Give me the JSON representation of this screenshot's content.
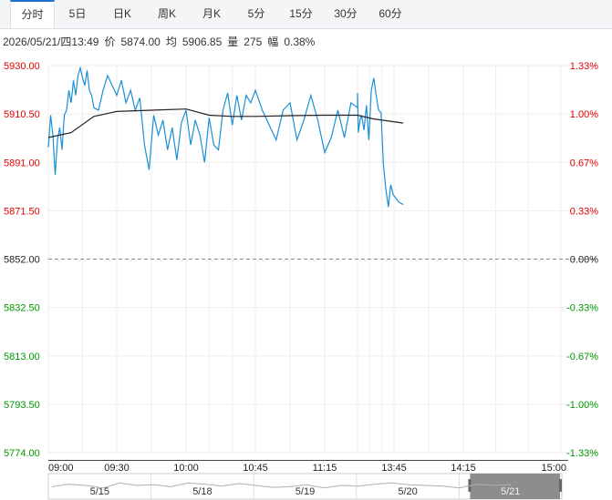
{
  "tabs": [
    {
      "label": "分时",
      "active": true
    },
    {
      "label": "5日"
    },
    {
      "label": "日K"
    },
    {
      "label": "周K"
    },
    {
      "label": "月K"
    },
    {
      "label": "5分"
    },
    {
      "label": "15分"
    },
    {
      "label": "30分"
    },
    {
      "label": "60分"
    }
  ],
  "info": {
    "datetime": "2026/05/21/四13:49",
    "price_label": "价",
    "price": "5874.00",
    "avg_label": "均",
    "avg": "5906.85",
    "vol_label": "量",
    "vol": "275",
    "amp_label": "幅",
    "amp": "0.38%"
  },
  "colors": {
    "up": "#e60000",
    "down": "#009900",
    "base": "#222222",
    "price_line": "#1b8fd6",
    "avg_line": "#222222"
  },
  "chart_data": {
    "type": "line",
    "base_price": 5852.0,
    "ylim": [
      5774.0,
      5930.0
    ],
    "y_ticks": [
      "5930.00",
      "5910.50",
      "5891.00",
      "5871.50",
      "5852.00",
      "5832.50",
      "5813.00",
      "5793.50",
      "5774.00"
    ],
    "pct_ticks": [
      "1.33%",
      "1.00%",
      "0.67%",
      "0.33%",
      "0.00%",
      "-0.33%",
      "-0.67%",
      "-1.00%",
      "-1.33%"
    ],
    "x_ticks": [
      "09:00",
      "09:30",
      "10:00",
      "10:45",
      "11:15",
      "13:45",
      "14:15",
      "15:00"
    ],
    "series": [
      {
        "key": "price",
        "x": [
          "09:00",
          "09:01",
          "09:02",
          "09:03",
          "09:04",
          "09:05",
          "09:06",
          "09:07",
          "09:08",
          "09:09",
          "09:10",
          "09:11",
          "09:12",
          "09:13",
          "09:14",
          "09:15",
          "09:16",
          "09:17",
          "09:18",
          "09:19",
          "09:20",
          "09:22",
          "09:24",
          "09:26",
          "09:28",
          "09:30",
          "09:32",
          "09:34",
          "09:36",
          "09:38",
          "09:40",
          "09:42",
          "09:44",
          "09:46",
          "09:48",
          "09:50",
          "09:52",
          "09:54",
          "09:56",
          "09:58",
          "10:00",
          "10:03",
          "10:06",
          "10:09",
          "10:12",
          "10:15",
          "10:18",
          "10:21",
          "10:24",
          "10:27",
          "10:30",
          "10:33",
          "10:36",
          "10:39",
          "10:42",
          "10:45",
          "10:48",
          "10:51",
          "10:54",
          "10:57",
          "11:00",
          "11:03",
          "11:06",
          "11:09",
          "11:12",
          "11:15",
          "11:18",
          "11:21",
          "11:24",
          "11:27",
          "11:30",
          "13:00",
          "13:01",
          "13:03",
          "13:05",
          "13:08",
          "13:11",
          "13:14",
          "13:17",
          "13:20",
          "13:23",
          "13:26",
          "13:29",
          "13:32",
          "13:35",
          "13:38",
          "13:41",
          "13:44",
          "13:47",
          "13:49"
        ],
        "values": [
          5897,
          5910,
          5902,
          5886,
          5900,
          5905,
          5896,
          5910,
          5912,
          5920,
          5915,
          5924,
          5918,
          5926,
          5929,
          5925,
          5922,
          5928,
          5920,
          5918,
          5913,
          5912,
          5920,
          5926,
          5922,
          5918,
          5924,
          5915,
          5920,
          5912,
          5917,
          5898,
          5888,
          5910,
          5902,
          5908,
          5896,
          5905,
          5892,
          5907,
          5912,
          5898,
          5908,
          5902,
          5891,
          5909,
          5898,
          5896,
          5912,
          5919,
          5906,
          5918,
          5908,
          5918,
          5915,
          5920,
          5912,
          5906,
          5900,
          5912,
          5915,
          5900,
          5908,
          5918,
          5908,
          5895,
          5901,
          5912,
          5901,
          5915,
          5913,
          5919,
          5903,
          5908,
          5910,
          5904,
          5914,
          5900,
          5920,
          5925,
          5918,
          5912,
          5911,
          5890,
          5880,
          5873,
          5882,
          5878,
          5875,
          5874
        ]
      },
      {
        "key": "avg",
        "x": [
          "09:00",
          "09:10",
          "09:20",
          "09:30",
          "09:45",
          "10:00",
          "10:15",
          "10:30",
          "10:45",
          "11:00",
          "11:15",
          "11:30",
          "13:00",
          "13:20",
          "13:49"
        ],
        "values": [
          5901,
          5903,
          5909.5,
          5911.5,
          5912,
          5912.5,
          5910,
          5909.5,
          5909.5,
          5909.8,
          5910,
          5910,
          5910,
          5908.5,
          5906.85
        ]
      }
    ],
    "navigator": {
      "labels": [
        "5/15",
        "5/18",
        "5/19",
        "5/20",
        "5/21"
      ],
      "selected": "5/21"
    }
  }
}
